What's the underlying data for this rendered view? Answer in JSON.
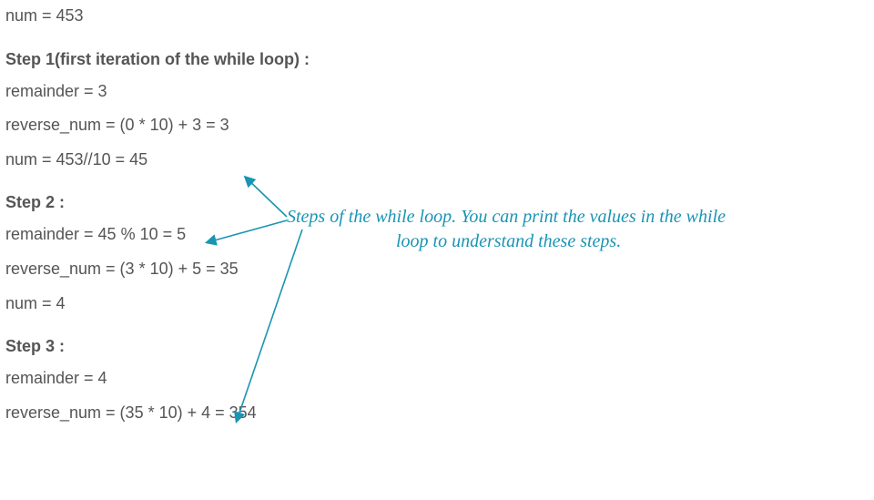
{
  "intro": {
    "num": "num = 453"
  },
  "step1": {
    "heading": "Step 1(first iteration of the while loop) :",
    "remainder": "remainder = 3",
    "reverse": "reverse_num = (0 * 10) + 3 = 3",
    "num": "num = 453//10 = 45"
  },
  "step2": {
    "heading": "Step 2 :",
    "remainder": "remainder = 45 % 10 = 5",
    "reverse": "reverse_num = (3 * 10) + 5 = 35",
    "num": "num = 4"
  },
  "step3": {
    "heading": "Step 3 :",
    "remainder": "remainder = 4",
    "reverse": "reverse_num = (35 * 10) + 4 = 354"
  },
  "annotation": {
    "line1": "Steps of the while loop. You can print the values in the while",
    "line2": "loop to understand these steps."
  },
  "colors": {
    "text": "#555555",
    "annotation": "#1a94b3"
  }
}
